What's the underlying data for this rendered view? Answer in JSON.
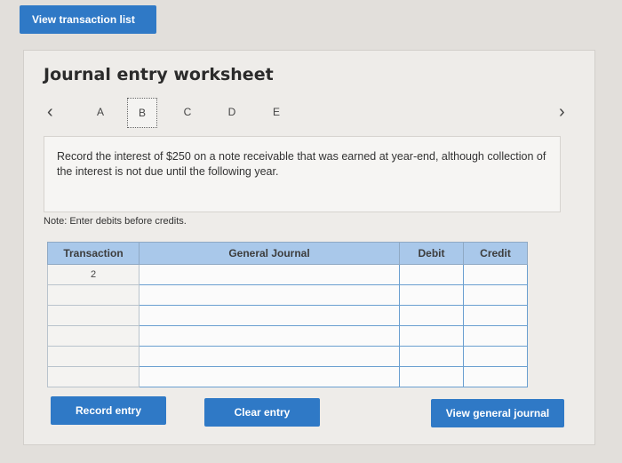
{
  "top_button": "View transaction list",
  "worksheet": {
    "title": "Journal entry worksheet",
    "tabs": [
      "A",
      "B",
      "C",
      "D",
      "E"
    ],
    "active_tab": "B",
    "prompt": "Record the interest of $250 on a note receivable that was earned at year-end, although collection of the interest is not due until the following year.",
    "note": "Note: Enter debits before credits."
  },
  "table": {
    "headers": [
      "Transaction",
      "General Journal",
      "Debit",
      "Credit"
    ],
    "rows": [
      {
        "transaction": "2"
      },
      {
        "transaction": ""
      },
      {
        "transaction": ""
      },
      {
        "transaction": ""
      },
      {
        "transaction": ""
      },
      {
        "transaction": ""
      }
    ]
  },
  "buttons": {
    "record": "Record entry",
    "clear": "Clear entry",
    "view_journal": "View general journal"
  },
  "colors": {
    "accent": "#2f79c6",
    "header_bg": "#a9c8ea"
  }
}
